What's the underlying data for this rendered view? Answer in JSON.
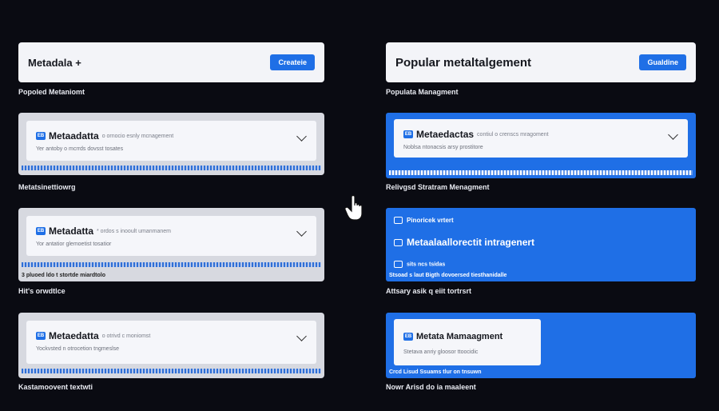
{
  "colors": {
    "background": "#0a0b12",
    "accent": "#1f6fe6",
    "card": "#f3f4f8"
  },
  "left": {
    "top_card": {
      "title": "Metadala +",
      "button": "Createie"
    },
    "top_caption": "Popoled Metaniomt",
    "panels": [
      {
        "icon": "EB",
        "title": "Metaadatta",
        "tag": "o ornocio esnly mcnagement",
        "sub": "Yer antoby o mcrrds dovsst tosates",
        "caption": "Metatsinettiowrg",
        "note": ""
      },
      {
        "icon": "EB",
        "title": "Metadatta",
        "tag": "* ordos s inooult umanmanem",
        "sub": "Yor antatior glemoetist tosatior",
        "caption": "Hit's orwdtlce",
        "note": "3 pluoed ldo t stortde miardtolo"
      },
      {
        "icon": "EB",
        "title": "Metaedatta",
        "tag": "o otrivd c moniomst",
        "sub": "Yockvsted n otrocetion tngmeslse",
        "caption": "Kastamoovent textwti",
        "note": ""
      }
    ]
  },
  "right": {
    "top_card": {
      "title": "Popular metaltalgement",
      "button": "Gualdine"
    },
    "top_caption": "Populata Managment",
    "panel1": {
      "icon": "EB",
      "title": "Metaedactas",
      "tag": "contiul o crenscs mragoment",
      "sub": "Noblsa ntonacsis arsy prostitore",
      "caption": "Relivgsd Stratram Menagment"
    },
    "panel2": {
      "line1": "Pinoricek vrtert",
      "line2": "Metaalaallorectit intragenert",
      "line3": "sits ncs tsidas",
      "note": "Stsoad s laut Bigth dovoersed tiesthanidalle",
      "caption": "Attsary asik q eiit tortrsrt"
    },
    "panel3": {
      "icon": "EB",
      "title": "Metata Mamaagment",
      "sub": "Stetava anriy gloosor ttoocidic",
      "note": "Crcd Lisud Ssuams tlur on tnsuwn",
      "caption": "Nowr Arisd do ia maaleent"
    }
  }
}
